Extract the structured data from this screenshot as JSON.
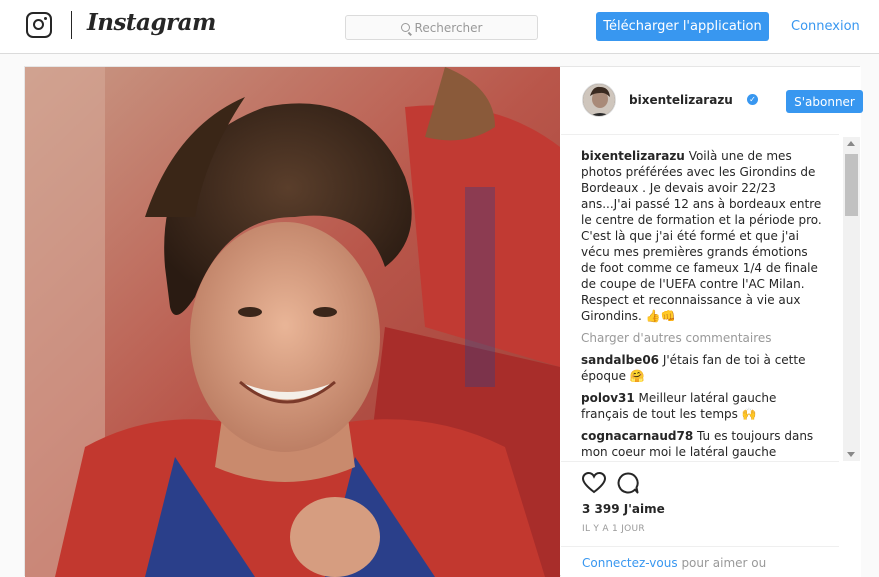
{
  "nav": {
    "brand": "Instagram",
    "search_placeholder": "Rechercher",
    "download_label": "Télécharger l'application",
    "login_label": "Connexion"
  },
  "post": {
    "username": "bixentelizarazu",
    "follow_label": "S'abonner",
    "caption": "Voilà une de mes photos préférées avec les Girondins de Bordeaux . Je devais avoir 22/23 ans...J'ai passé 12 ans à bordeaux entre le centre de formation et la période pro. C'est là que j'ai été formé et que j'ai vécu mes premières grands émotions de foot comme ce fameux 1/4 de finale de coupe de l'UEFA contre l'AC Milan. Respect et reconnaissance à vie aux Girondins. 👍👊",
    "load_more": "Charger d'autres commentaires",
    "comments": [
      {
        "user": "sandalbe06",
        "text": "J'étais fan de toi à cette époque 🤗"
      },
      {
        "user": "polov31",
        "text": "Meilleur latéral gauche français de tout les temps 🙌"
      },
      {
        "user": "cognacarnaud78",
        "text": "Tu es toujours dans mon coeur moi le latéral gauche comme"
      }
    ],
    "likes": "3 399 J'aime",
    "time": "IL Y A 1 JOUR",
    "login_connect": "Connectez-vous",
    "login_rest": "pour aimer ou"
  },
  "colors": {
    "accent": "#3897f0",
    "jersey_red": "#c2382f",
    "jersey_blue": "#2a3f8a"
  },
  "icons": [
    "search-icon",
    "heart-icon",
    "comment-icon",
    "verified-badge-icon",
    "instagram-logo-icon"
  ]
}
